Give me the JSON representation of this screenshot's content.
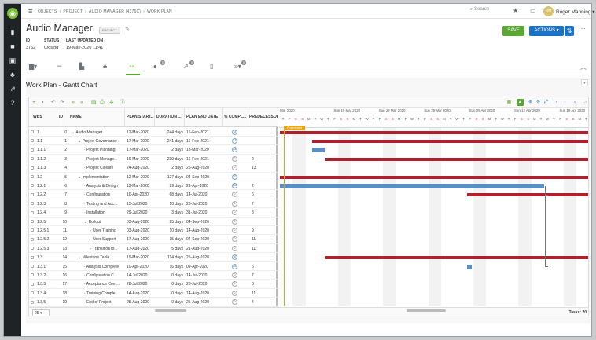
{
  "app": {
    "logo": "opportunity-logo-icon"
  },
  "rail_icons": [
    "dashboard-icon",
    "briefcase-icon",
    "chart-icon",
    "people-icon",
    "export-icon",
    "help-icon"
  ],
  "topbar": {
    "breadcrumbs": [
      "OBJECTS",
      "PROJECT",
      "AUDIO MANAGER (4376C)",
      "WORK PLAN"
    ],
    "search_placeholder": "Search",
    "user_name": "Roger Manning",
    "user_initials": "RM"
  },
  "record": {
    "title": "Audio Manager",
    "badge": "PROJECT",
    "fields": [
      {
        "label": "ID",
        "value": "3762"
      },
      {
        "label": "STATUS",
        "value": "Closing"
      },
      {
        "label": "LAST UPDATED ON",
        "value": "19-May-2020 11:41"
      }
    ],
    "save_label": "SAVE",
    "actions_label": "ACTIONS"
  },
  "tabs": [
    {
      "icon": "chart-bar-icon"
    },
    {
      "icon": "list-icon"
    },
    {
      "icon": "cubes-icon"
    },
    {
      "icon": "team-icon"
    },
    {
      "icon": "workplan-icon",
      "active": true
    },
    {
      "icon": "chat-icon",
      "count": "0"
    },
    {
      "icon": "share-icon",
      "count": "0"
    },
    {
      "icon": "file-icon"
    },
    {
      "icon": "link-icon",
      "count": "0"
    }
  ],
  "panel": {
    "title": "Work Plan - Gantt Chart"
  },
  "table": {
    "headers": [
      "WBS",
      "ID",
      "NAME",
      "PLAN START...",
      "DURATION ...",
      "PLAN END DATE",
      "% COMPL...",
      "PREDECESSORS"
    ],
    "rows": [
      {
        "wbs": "1",
        "id": "0",
        "name": "Audio Manager",
        "start": "12-Mar-2020",
        "dur": "244 days",
        "end": "16-Feb-2021",
        "pct": "43",
        "pred": "",
        "lvl": 0,
        "grp": true
      },
      {
        "wbs": "1.1",
        "id": "1",
        "name": "Project Governance",
        "start": "17-Mar-2020",
        "dur": "241 days",
        "end": "16-Feb-2021",
        "pct": "13",
        "pred": "",
        "lvl": 1,
        "grp": true
      },
      {
        "wbs": "1.1.1",
        "id": "2",
        "name": "Project Planning",
        "start": "17-Mar-2020",
        "dur": "2 days",
        "end": "18-Mar-2020",
        "pct": "100",
        "pred": "",
        "lvl": 2
      },
      {
        "wbs": "1.1.2",
        "id": "3",
        "name": "Project Manage...",
        "start": "19-Mar-2020",
        "dur": "239 days",
        "end": "16-Feb-2021",
        "pct": "0",
        "pred": "2",
        "lvl": 2
      },
      {
        "wbs": "1.1.3",
        "id": "4",
        "name": "Project Closure",
        "start": "24-Aug-2020",
        "dur": "2 days",
        "end": "25-Aug-2020",
        "pct": "0",
        "pred": "13",
        "lvl": 2
      },
      {
        "wbs": "1.2",
        "id": "5",
        "name": "Implementation",
        "start": "12-Mar-2020",
        "dur": "127 days",
        "end": "04-Sep-2020",
        "pct": "70",
        "pred": "",
        "lvl": 1,
        "grp": true
      },
      {
        "wbs": "1.2.1",
        "id": "6",
        "name": "Analysis & Design",
        "start": "12-Mar-2020",
        "dur": "29 days",
        "end": "21-Apr-2020",
        "pct": "100",
        "pred": "2",
        "lvl": 2
      },
      {
        "wbs": "1.2.2",
        "id": "7",
        "name": "Configuration",
        "start": "10-Apr-2020",
        "dur": "68 days",
        "end": "14-Jul-2020",
        "pct": "0",
        "pred": "6",
        "lvl": 2
      },
      {
        "wbs": "1.2.3",
        "id": "8",
        "name": "Testing and Acc...",
        "start": "15-Jul-2020",
        "dur": "10 days",
        "end": "28-Jul-2020",
        "pct": "0",
        "pred": "7",
        "lvl": 2
      },
      {
        "wbs": "1.2.4",
        "id": "9",
        "name": "Installation",
        "start": "29-Jul-2020",
        "dur": "3 days",
        "end": "31-Jul-2020",
        "pct": "0",
        "pred": "8",
        "lvl": 2
      },
      {
        "wbs": "1.2.5",
        "id": "10",
        "name": "Rollout",
        "start": "03-Aug-2020",
        "dur": "25 days",
        "end": "04-Sep-2020",
        "pct": "0",
        "pred": "",
        "lvl": 2,
        "grp": true
      },
      {
        "wbs": "1.2.5.1",
        "id": "11",
        "name": "User Training",
        "start": "03-Aug-2020",
        "dur": "10 days",
        "end": "14-Aug-2020",
        "pct": "0",
        "pred": "9",
        "lvl": 3
      },
      {
        "wbs": "1.2.5.2",
        "id": "12",
        "name": "User Support",
        "start": "17-Aug-2020",
        "dur": "15 days",
        "end": "04-Sep-2020",
        "pct": "0",
        "pred": "11",
        "lvl": 3
      },
      {
        "wbs": "1.2.5.3",
        "id": "13",
        "name": "Transition to...",
        "start": "17-Aug-2020",
        "dur": "5 days",
        "end": "21-Aug-2020",
        "pct": "0",
        "pred": "11",
        "lvl": 3
      },
      {
        "wbs": "1.3",
        "id": "14",
        "name": "Milestone Table",
        "start": "19-Mar-2020",
        "dur": "114 days",
        "end": "25-Aug-2020",
        "pct": "50",
        "pred": "",
        "lvl": 1,
        "grp": true
      },
      {
        "wbs": "1.3.1",
        "id": "15",
        "name": "Analysis Complete",
        "start": "10-Apr-2020",
        "dur": "16 days",
        "end": "09-Apr-2020",
        "pct": "100",
        "pred": "6",
        "lvl": 2
      },
      {
        "wbs": "1.3.2",
        "id": "16",
        "name": "Configuration C...",
        "start": "14-Jul-2020",
        "dur": "0 days",
        "end": "14-Jul-2020",
        "pct": "0",
        "pred": "7",
        "lvl": 2
      },
      {
        "wbs": "1.3.3",
        "id": "17",
        "name": "Acceptance Com...",
        "start": "28-Jul-2020",
        "dur": "0 days",
        "end": "28-Jul-2020",
        "pct": "0",
        "pred": "8",
        "lvl": 2
      },
      {
        "wbs": "1.3.4",
        "id": "18",
        "name": "Training Comple...",
        "start": "14-Aug-2020",
        "dur": "0 days",
        "end": "14-Aug-2020",
        "pct": "0",
        "pred": "11",
        "lvl": 2
      },
      {
        "wbs": "1.3.5",
        "id": "19",
        "name": "End of Project",
        "start": "25-Aug-2020",
        "dur": "0 days",
        "end": "25-Aug-2020",
        "pct": "0",
        "pred": "4",
        "lvl": 2
      }
    ]
  },
  "gantt": {
    "weeks": [
      "Mar 2020",
      "Sun 15 Mar 2020",
      "Sun 22 Mar 2020",
      "Sun 29 Mar 2020",
      "Sun 05 Apr 2020",
      "Sun 12 Apr 2020",
      "Sun 19 Apr 2020",
      "Sun 26 Apr 2020"
    ],
    "day_letters": [
      "T",
      "W",
      "T",
      "F",
      "S",
      "S",
      "M"
    ],
    "project_start_label": "Project start"
  },
  "footer": {
    "page_size": "25",
    "tasks_label": "Tasks: 20"
  }
}
